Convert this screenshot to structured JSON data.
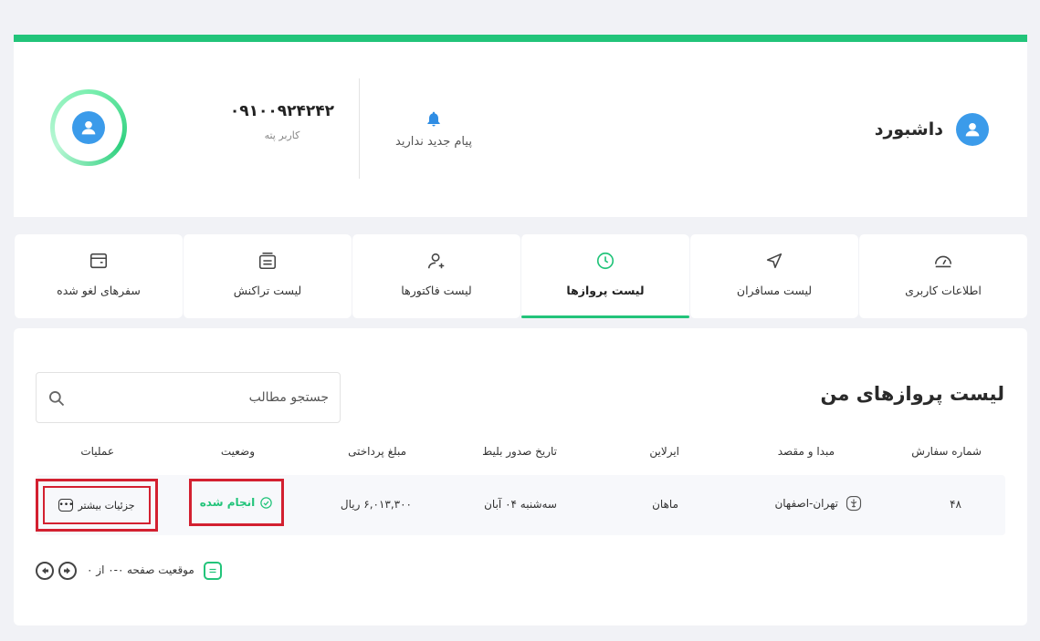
{
  "header": {
    "dashboard_label": "داشبورد",
    "notification_text": "پیام جدید ندارید",
    "phone": "۰۹۱۰۰۹۲۴۲۴۲",
    "role": "کاربر پته"
  },
  "tabs": [
    {
      "label": "اطلاعات کاربری",
      "icon": "gauge-icon"
    },
    {
      "label": "لیست مسافران",
      "icon": "navigation-arrow-icon"
    },
    {
      "label": "لیست پروازها",
      "icon": "clock-icon",
      "active": true
    },
    {
      "label": "لیست فاکتورها",
      "icon": "user-icon"
    },
    {
      "label": "لیست تراکنش",
      "icon": "receipt-icon"
    },
    {
      "label": "سفرهای لغو شده",
      "icon": "card-icon"
    }
  ],
  "main": {
    "title": "لیست پروازهای من",
    "search_placeholder": "جستجو مطالب",
    "columns": {
      "order_number": "شماره سفارش",
      "route": "مبدا و مقصد",
      "airline": "ایرلاین",
      "issue_date": "تاریخ صدور بلیط",
      "amount": "مبلغ پرداختی",
      "status": "وضعیت",
      "actions": "عملیات"
    },
    "rows": [
      {
        "order_number": "۴۸",
        "route": "تهران-اصفهان",
        "airline": "ماهان",
        "issue_date": "سه‌شنبه ۰۴ آبان",
        "amount": "۶,۰۱۳,۳۰۰ ریال",
        "status": "انجام شده",
        "details_label": "جزئیات بیشتر"
      }
    ]
  },
  "pager": {
    "position_label": "موقعیت صفحه",
    "range_text": "۰-۰ از ۰"
  },
  "colors": {
    "accent": "#22c47a",
    "avatar_blue": "#3b9bea",
    "highlight_red": "#d32030"
  }
}
